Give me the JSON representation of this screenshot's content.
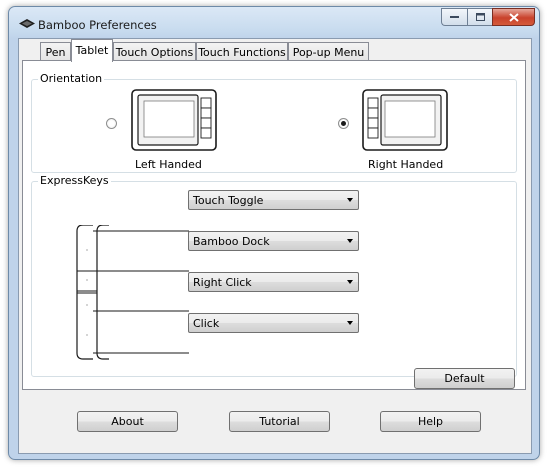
{
  "window": {
    "title": "Bamboo Preferences"
  },
  "tabs": [
    {
      "label": "Pen"
    },
    {
      "label": "Tablet"
    },
    {
      "label": "Touch Options"
    },
    {
      "label": "Touch Functions"
    },
    {
      "label": "Pop-up Menu"
    }
  ],
  "active_tab": "Tablet",
  "orientation": {
    "group_label": "Orientation",
    "left_label": "Left Handed",
    "right_label": "Right Handed",
    "selected": "Right Handed"
  },
  "expresskeys": {
    "group_label": "ExpressKeys",
    "keys": [
      {
        "value": "Touch Toggle"
      },
      {
        "value": "Bamboo Dock"
      },
      {
        "value": "Right Click"
      },
      {
        "value": "Click"
      }
    ]
  },
  "buttons": {
    "default": "Default",
    "about": "About",
    "tutorial": "Tutorial",
    "help": "Help"
  },
  "icons": {
    "app": "bamboo-icon",
    "combo_arrow": "chevron-down-icon"
  }
}
